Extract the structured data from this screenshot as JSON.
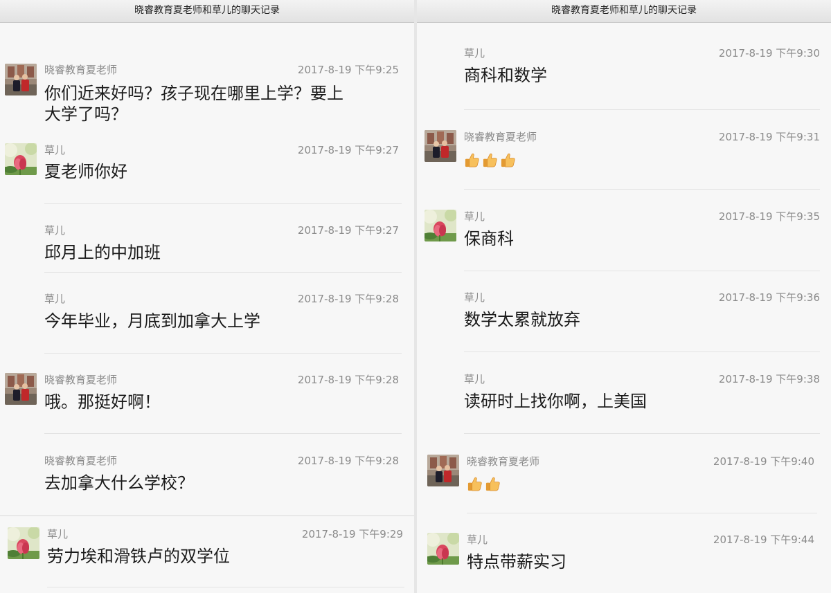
{
  "left_panel": {
    "title": "晓睿教育夏老师和草儿的聊天记录",
    "messages": [
      {
        "sender": "晓睿教育夏老师",
        "time": "2017-8-19 下午9:25",
        "text_line1": "你们近来好吗？孩子现在哪里上学？要上",
        "text_line2": "大学了吗？"
      },
      {
        "sender": "草儿",
        "time": "2017-8-19 下午9:27",
        "text": "夏老师你好"
      },
      {
        "sender": "草儿",
        "time": "2017-8-19 下午9:27",
        "text": "邱月上的中加班"
      },
      {
        "sender": "草儿",
        "time": "2017-8-19 下午9:28",
        "text": "今年毕业，月底到加拿大上学"
      },
      {
        "sender": "晓睿教育夏老师",
        "time": "2017-8-19 下午9:28",
        "text": "哦。那挺好啊！"
      },
      {
        "sender": "晓睿教育夏老师",
        "time": "2017-8-19 下午9:28",
        "text": "去加拿大什么学校？"
      },
      {
        "sender": "草儿",
        "time": "2017-8-19 下午9:29",
        "text": "劳力埃和滑铁卢的双学位"
      }
    ]
  },
  "right_panel": {
    "title": "晓睿教育夏老师和草儿的聊天记录",
    "messages": [
      {
        "sender": "草儿",
        "time": "2017-8-19 下午9:30",
        "text": "商科和数学"
      },
      {
        "sender": "晓睿教育夏老师",
        "time": "2017-8-19 下午9:31",
        "emoji": "thumbs-up x3"
      },
      {
        "sender": "草儿",
        "time": "2017-8-19 下午9:35",
        "text": "保商科"
      },
      {
        "sender": "草儿",
        "time": "2017-8-19 下午9:36",
        "text": "数学太累就放弃"
      },
      {
        "sender": "草儿",
        "time": "2017-8-19 下午9:38",
        "text": "读研时上找你啊，上美国"
      },
      {
        "sender": "晓睿教育夏老师",
        "time": "2017-8-19 下午9:40",
        "emoji": "thumbs-up x2"
      },
      {
        "sender": "草儿",
        "time": "2017-8-19 下午9:44",
        "text": "特点带薪实习"
      }
    ]
  },
  "icons": {
    "teacher_avatar": "teacher-photo-avatar-icon",
    "caoer_avatar": "lotus-flower-avatar-icon",
    "emoji": "thumbs-up-icon"
  },
  "colors": {
    "panel_bg": "#f7f7f7",
    "meta_text": "#8a8a8a",
    "message_text": "#1a1a1a",
    "divider": "#e3e3e3"
  }
}
